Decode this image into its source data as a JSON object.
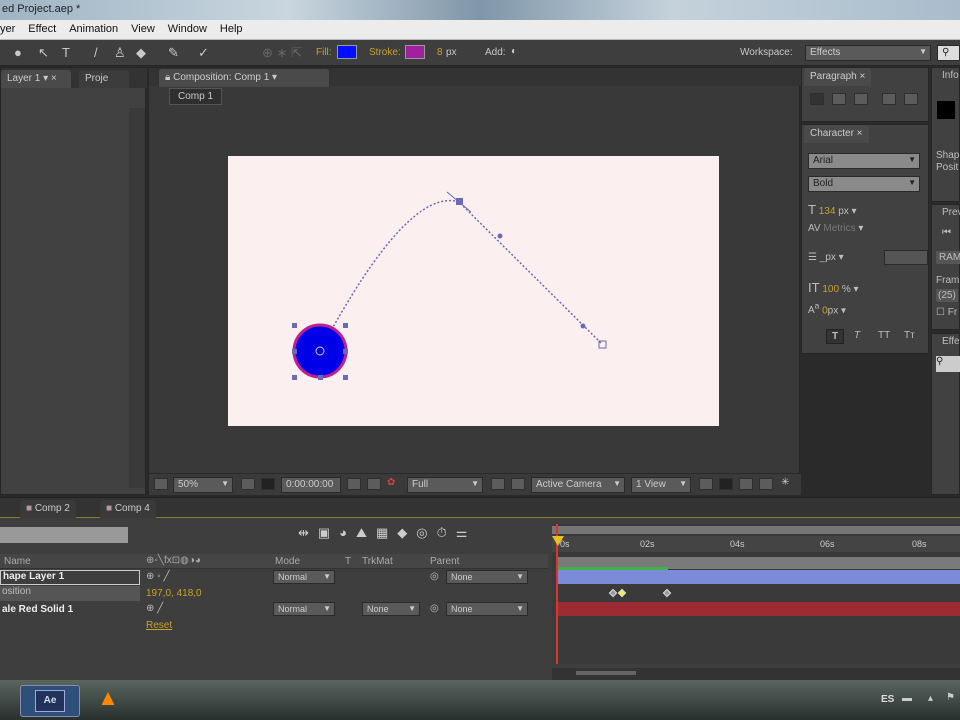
{
  "window": {
    "title": "ed Project.aep *"
  },
  "menu": [
    "yer",
    "Effect",
    "Animation",
    "View",
    "Window",
    "Help"
  ],
  "toolbar": {
    "fill_label": "Fill:",
    "fill_color": "#0010ff",
    "stroke_label": "Stroke:",
    "stroke_color": "#a020a0",
    "stroke_width": "8",
    "stroke_unit": "px",
    "add_label": "Add:",
    "workspace_label": "Workspace:",
    "workspace_value": "Effects"
  },
  "left_panel": {
    "tab1": "Layer 1",
    "tab2": "Proje"
  },
  "composition": {
    "tab": "Composition: Comp 1",
    "breadcrumb": "Comp 1",
    "canvas_color": "#fbeff0",
    "shape_color": "#0000e8",
    "shape_stroke": "#c0208c"
  },
  "viewer_bar": {
    "zoom": "50%",
    "timecode": "0:00:00:00",
    "resolution": "Full",
    "camera": "Active Camera",
    "views": "1 View"
  },
  "paragraph": {
    "tab": "Paragraph"
  },
  "character": {
    "tab": "Character",
    "font": "Arial",
    "style": "Bold",
    "size": "134",
    "size_unit": "px",
    "kerning": "Metrics",
    "leading_unit": "px",
    "vscale": "100",
    "vscale_unit": "%",
    "baseline": "0",
    "baseline_unit": "px",
    "btn_bold": "T",
    "btn_italic": "T",
    "btn_caps": "TT",
    "btn_smallcaps": "Tт"
  },
  "right_strip": {
    "info": "Info",
    "shape": "Shap",
    "position": "Posit",
    "preview": "Prev",
    "ram": "RAM",
    "frame": "Fram",
    "frame_val": "(25)",
    "fr": "Fr",
    "effects": "Effe"
  },
  "timeline": {
    "tabs": [
      "Comp 2",
      "Comp 4"
    ],
    "columns": {
      "name": "Name",
      "mode": "Mode",
      "t": "T",
      "trkmat": "TrkMat",
      "parent": "Parent"
    },
    "ruler": [
      "0s",
      "02s",
      "04s",
      "06s",
      "08s"
    ],
    "layers": [
      {
        "name": "hape Layer 1",
        "mode": "Normal",
        "parent": "None"
      },
      {
        "name": "osition",
        "value": "197,0, 418,0"
      },
      {
        "name": "ale Red Solid 1",
        "mode": "Normal",
        "trkmat": "None",
        "parent": "None"
      },
      {
        "name": "",
        "value": "Reset"
      }
    ]
  },
  "taskbar": {
    "ae": "Ae",
    "lang": "ES"
  }
}
